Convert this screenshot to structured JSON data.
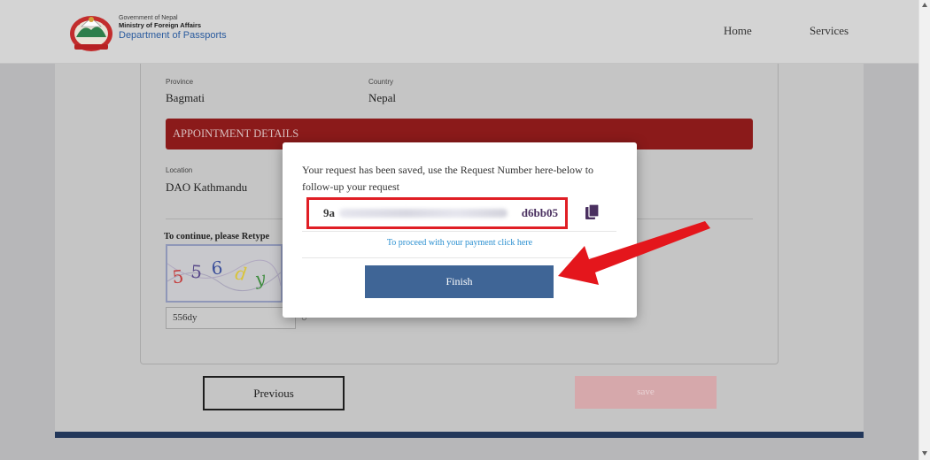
{
  "header": {
    "gov": "Government of Nepal",
    "ministry": "Ministry of Foreign Affairs",
    "department": "Department of Passports",
    "nav": [
      "Home",
      "Services"
    ]
  },
  "icons": {
    "emblem": "nepal-emblem-icon",
    "copy": "copy-icon",
    "arrow": "red-arrow-icon"
  },
  "address": {
    "province_label": "Province",
    "province_value": "Bagmati",
    "country_label": "Country",
    "country_value": "Nepal"
  },
  "appointment": {
    "heading": "APPOINTMENT DETAILS",
    "location_label": "Location",
    "location_value": "DAO Kathmandu"
  },
  "captcha": {
    "prompt": "To continue, please Retype",
    "image_text": [
      "5",
      "5",
      "6",
      "d",
      "y"
    ],
    "input_value": "556dy"
  },
  "buttons": {
    "previous": "Previous",
    "save": "save"
  },
  "modal": {
    "message": "Your request has been saved, use the Request Number here-below to follow-up your request",
    "request_start": "9a",
    "request_end": "d6bb05",
    "payment_link": "To proceed with your payment click here",
    "finish": "Finish"
  },
  "colors": {
    "header_bg": "#d4d4d4",
    "section_head": "#8b1a1a",
    "finish_button": "#3f6596",
    "highlight_box": "#e01e25",
    "link": "#2a8fd0"
  }
}
